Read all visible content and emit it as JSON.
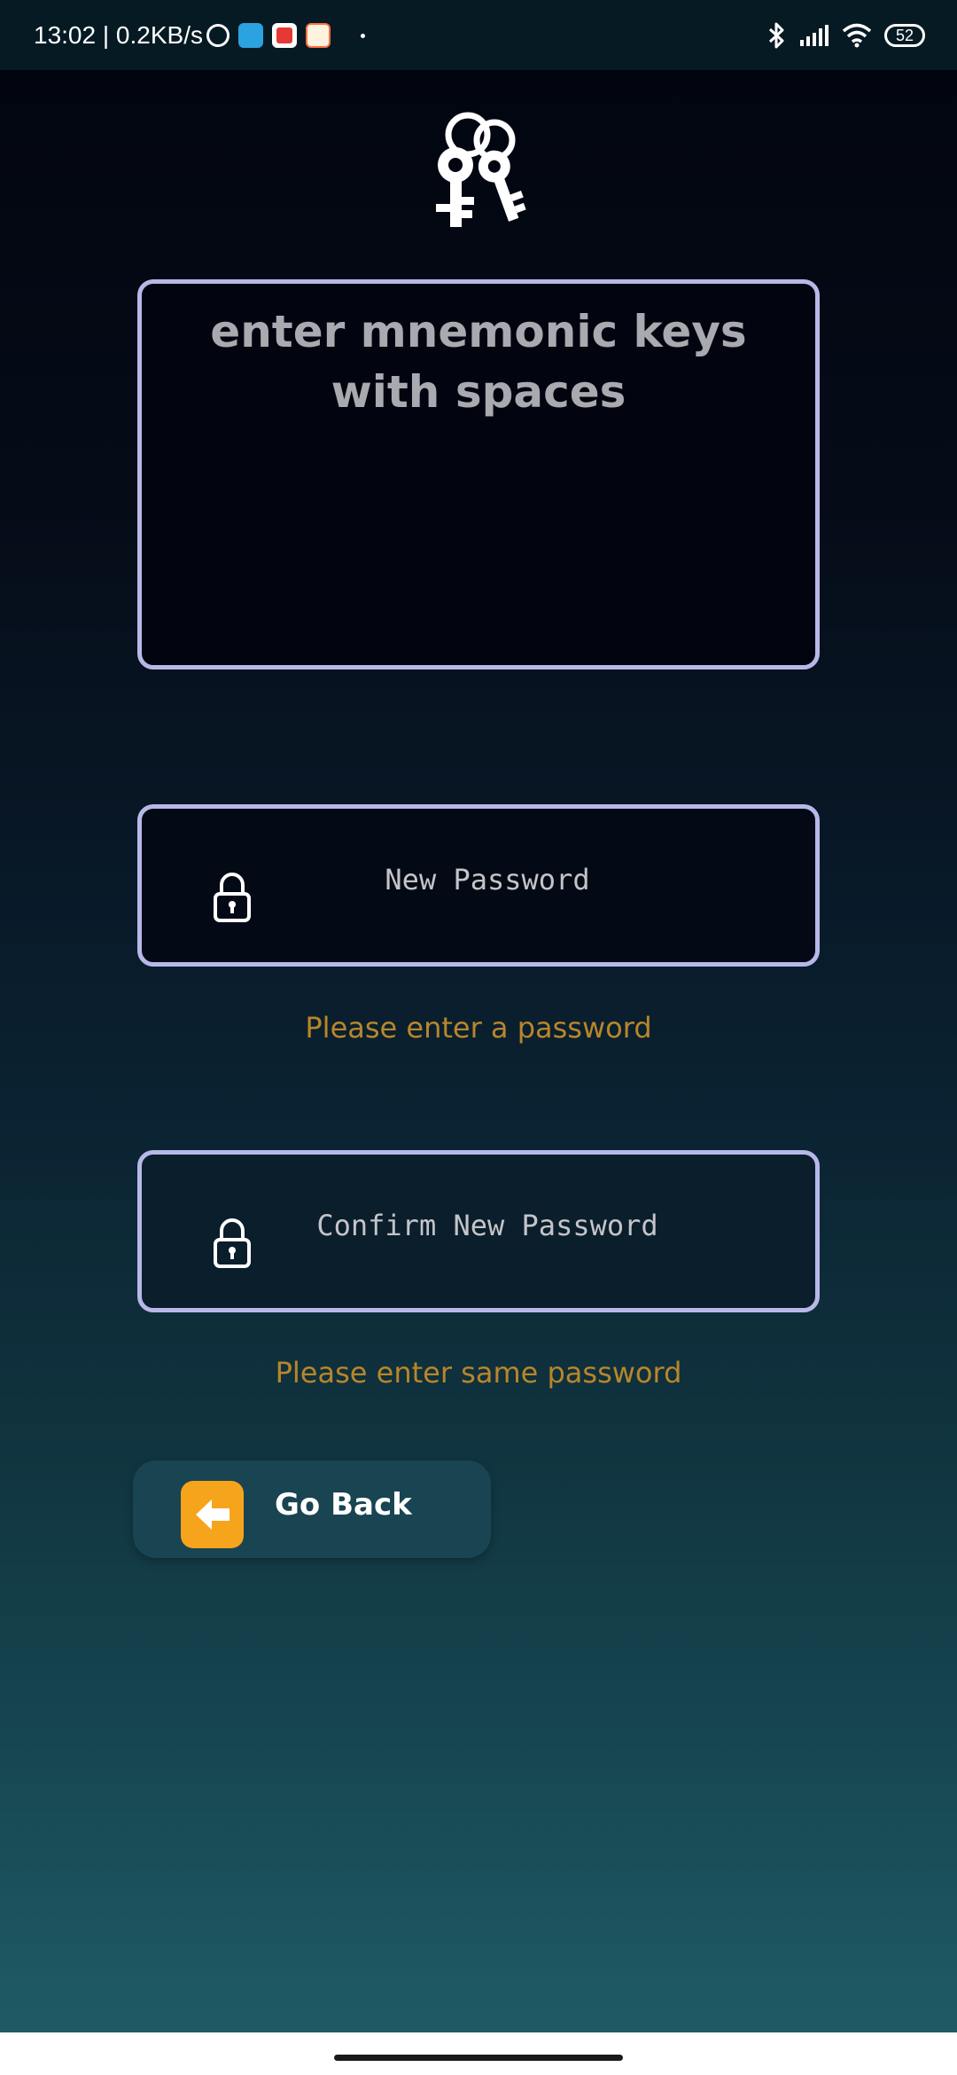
{
  "status_bar": {
    "time": "13:02",
    "network_speed": "0.2KB/s",
    "battery_level": "52",
    "notification_icons": [
      "alarm-icon",
      "telegram-icon",
      "app-notification-icon",
      "app-notification-icon"
    ],
    "status_icons": [
      "bluetooth-icon",
      "signal-icon",
      "wifi-icon",
      "battery-icon"
    ]
  },
  "logo": {
    "icon": "keys-icon"
  },
  "mnemonic": {
    "placeholder": "enter mnemonic keys with spaces",
    "value": ""
  },
  "new_password": {
    "placeholder": "New Password",
    "value": "",
    "icon": "lock-icon",
    "error": "Please enter a password"
  },
  "confirm_password": {
    "placeholder": "Confirm New Password",
    "value": "",
    "icon": "lock-icon",
    "error": "Please enter same password"
  },
  "go_back": {
    "label": "Go Back",
    "icon": "arrow-left-icon"
  },
  "colors": {
    "border": "#b7b8e8",
    "error": "#b8862a",
    "accent": "#f7a41d",
    "button_bg": "#194451",
    "background_top": "#02050f",
    "background_bottom": "#1f5b65"
  }
}
